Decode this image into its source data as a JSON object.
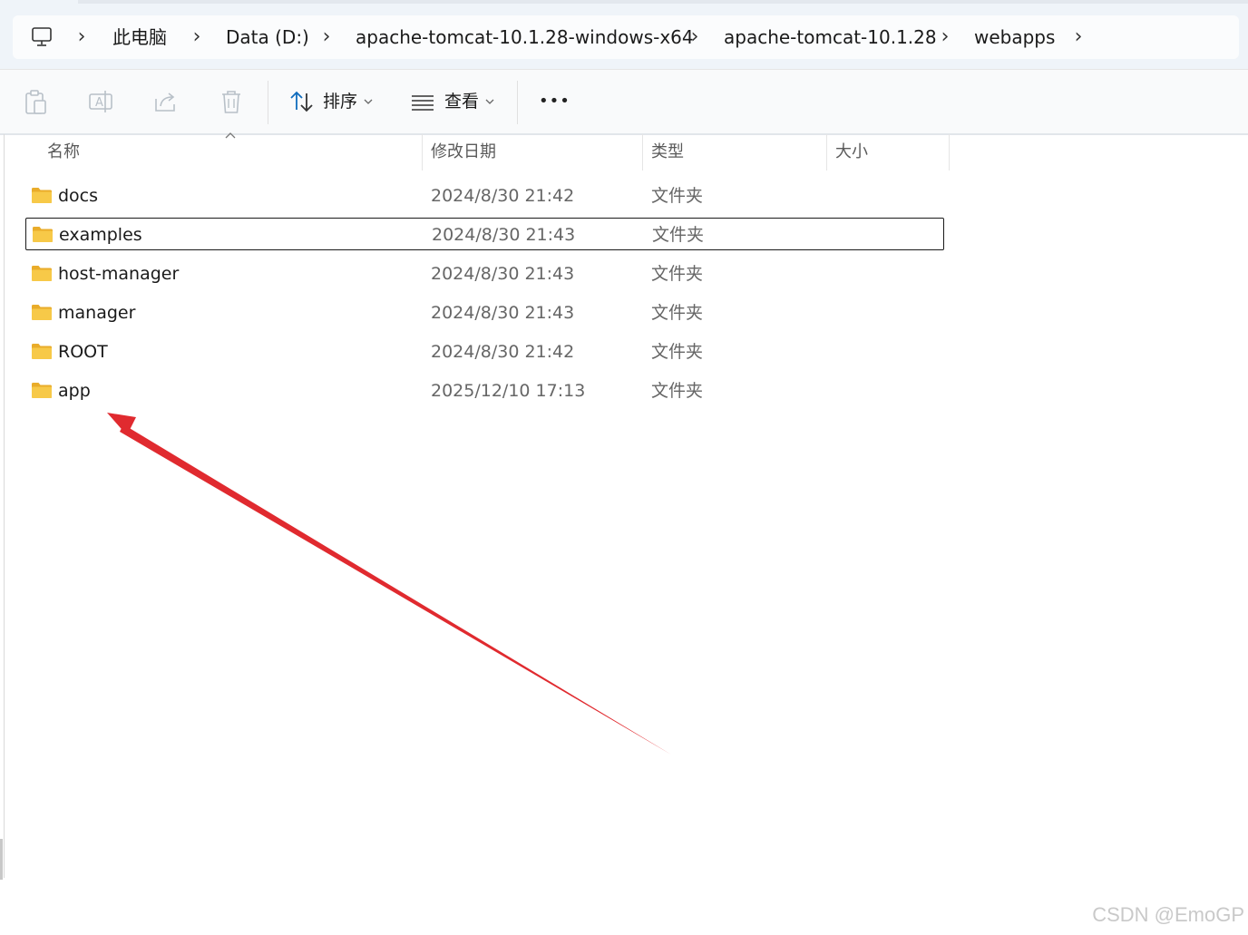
{
  "breadcrumb": {
    "root_icon": "monitor-icon",
    "items": [
      "此电脑",
      "Data (D:)",
      "apache-tomcat-10.1.28-windows-x64",
      "apache-tomcat-10.1.28",
      "webapps"
    ]
  },
  "toolbar": {
    "icons": [
      "paste-icon",
      "rename-icon",
      "share-icon",
      "delete-icon"
    ],
    "sort_label": "排序",
    "view_label": "查看",
    "more_label": "•••"
  },
  "columns": {
    "name": "名称",
    "date": "修改日期",
    "type": "类型",
    "size": "大小"
  },
  "files": [
    {
      "name": "docs",
      "date": "2024/8/30 21:42",
      "type": "文件夹",
      "focused": false
    },
    {
      "name": "examples",
      "date": "2024/8/30 21:43",
      "type": "文件夹",
      "focused": true
    },
    {
      "name": "host-manager",
      "date": "2024/8/30 21:43",
      "type": "文件夹",
      "focused": false
    },
    {
      "name": "manager",
      "date": "2024/8/30 21:43",
      "type": "文件夹",
      "focused": false
    },
    {
      "name": "ROOT",
      "date": "2024/8/30 21:42",
      "type": "文件夹",
      "focused": false
    },
    {
      "name": "app",
      "date": "2025/12/10 17:13",
      "type": "文件夹",
      "focused": false
    }
  ],
  "annotation": {
    "color": "#e02a2f",
    "points_to": "app"
  },
  "watermark": "CSDN @EmoGP",
  "colors": {
    "folder": "#f7c948",
    "folder_dark": "#e9ac2a",
    "accent": "#0f6cbd"
  }
}
